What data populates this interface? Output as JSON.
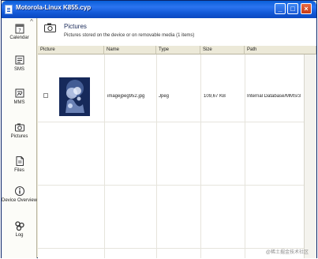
{
  "window": {
    "title": "Motorola-Linux K855.cyp"
  },
  "titlebar_buttons": {
    "minimize": "_",
    "maximize": "□",
    "close": "×"
  },
  "sidebar": {
    "scroll_up": "^",
    "items": [
      {
        "label": "Calendar",
        "icon": "calendar-icon"
      },
      {
        "label": "SMS",
        "icon": "sms-icon"
      },
      {
        "label": "MMS",
        "icon": "mms-icon"
      },
      {
        "label": "Pictures",
        "icon": "camera-icon"
      },
      {
        "label": "Files",
        "icon": "files-icon"
      },
      {
        "label": "Device Overview",
        "icon": "info-icon"
      },
      {
        "label": "Log",
        "icon": "log-icon"
      }
    ]
  },
  "header": {
    "title": "Pictures",
    "subtitle": "Pictures stored on the device or on removable media (1 items)",
    "icon": "camera-icon"
  },
  "table": {
    "columns": [
      "Picture",
      "Name",
      "Type",
      "Size",
      "Path"
    ],
    "rows": [
      {
        "checked": false,
        "name": "imagejpeg952.jpg",
        "type": "Jpeg",
        "size": "109,67 KB",
        "path": "Internal Database/MMS/3"
      }
    ]
  },
  "watermark": "@稀土掘金技术社区",
  "colors": {
    "titlebar": "#1258d6",
    "frame": "#ece9d8",
    "header_text": "#1b2b5a"
  }
}
